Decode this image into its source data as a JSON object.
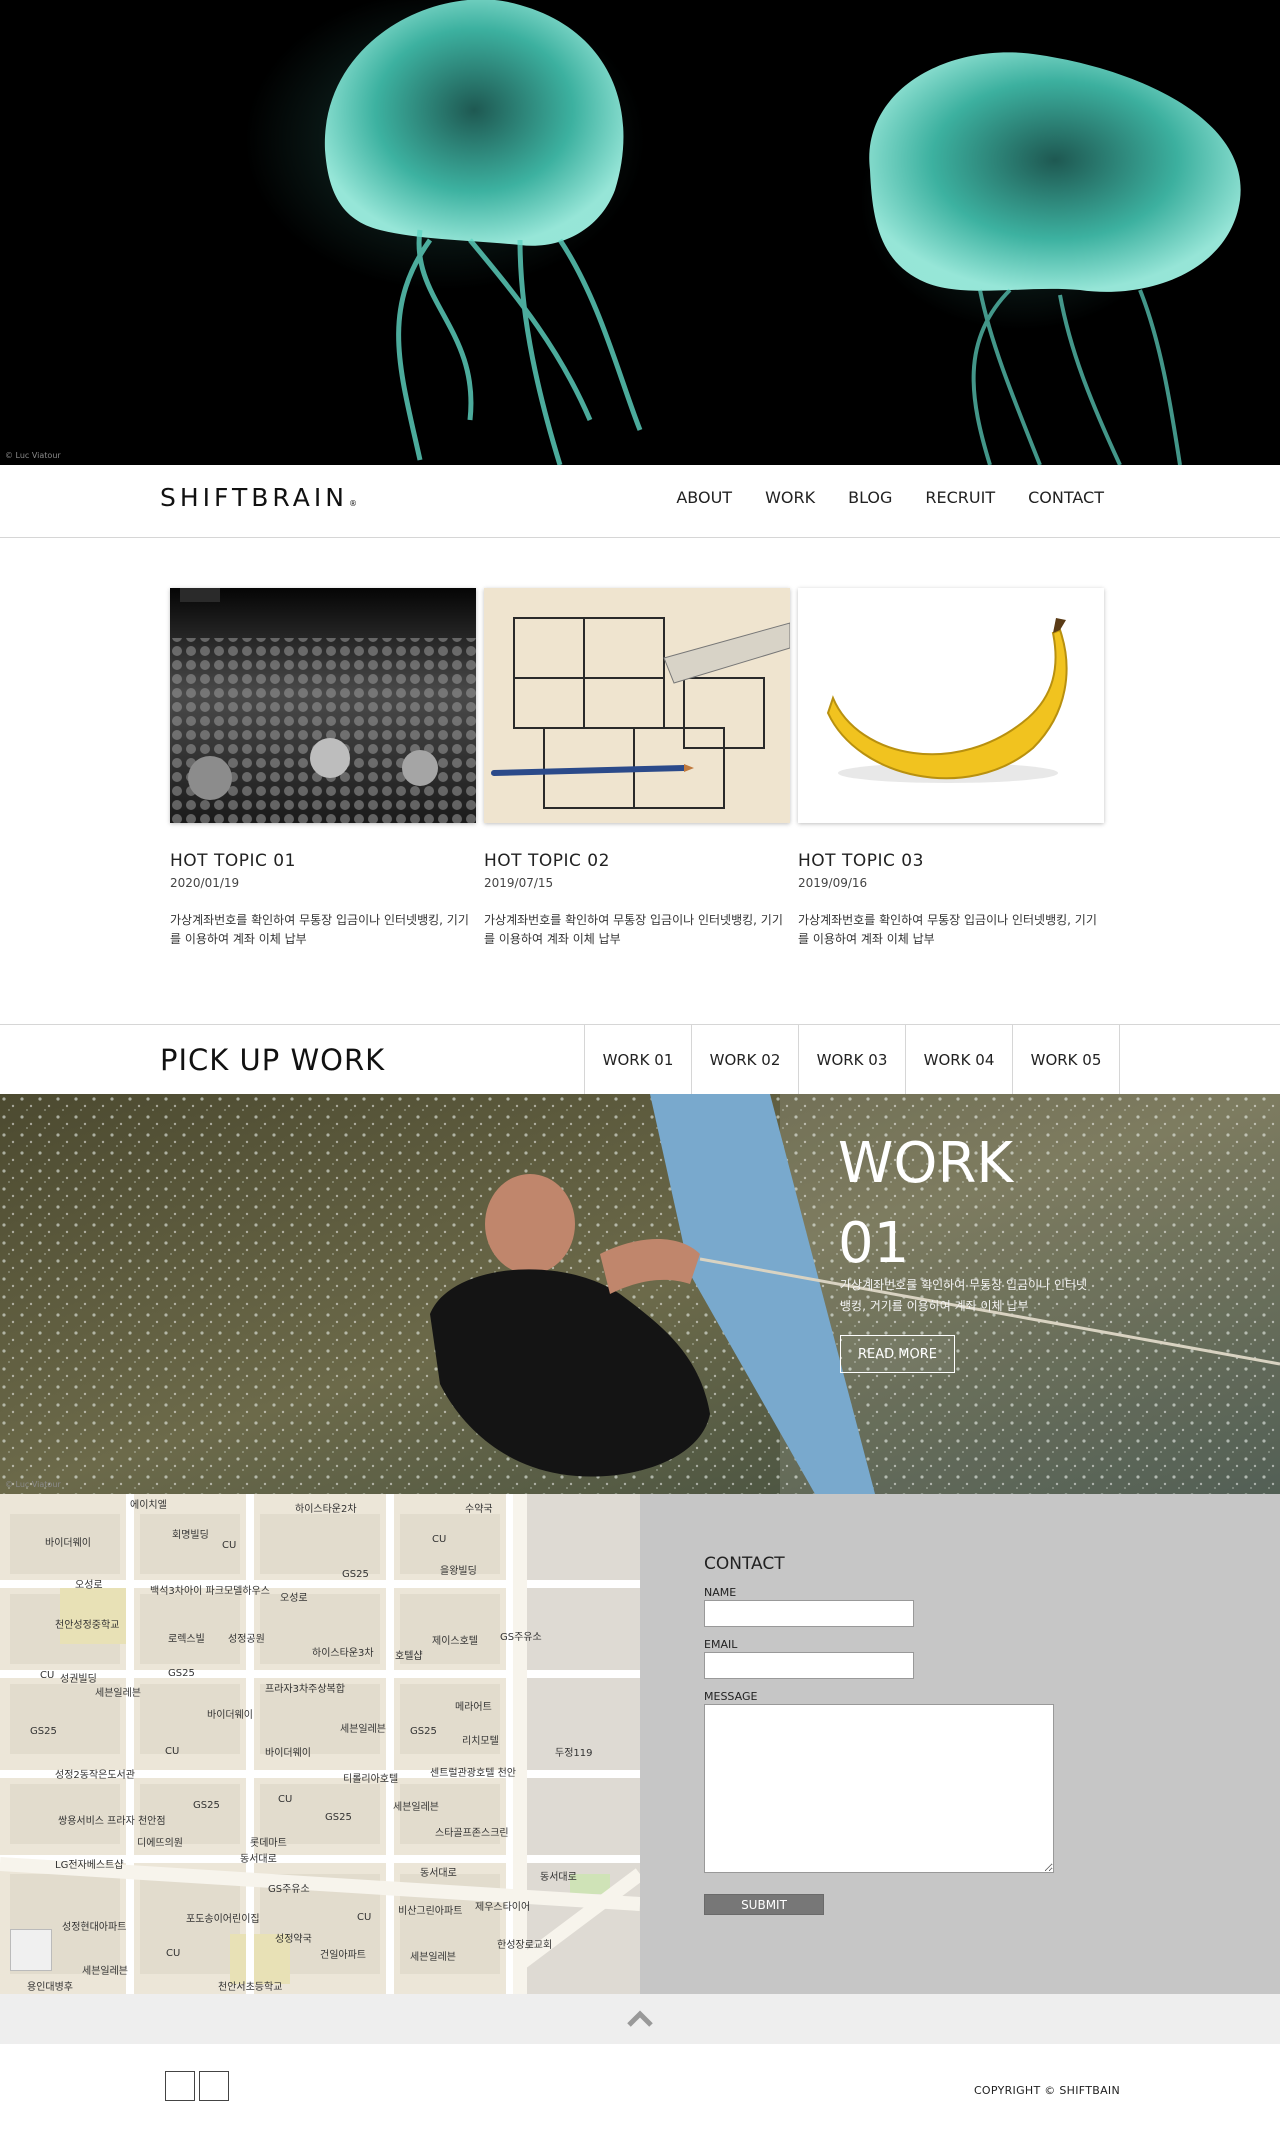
{
  "hero": {
    "credit": "© Luc Viatour"
  },
  "header": {
    "logo": "SHIFTBRAIN",
    "logo_mark": "®",
    "nav": [
      "ABOUT",
      "WORK",
      "BLOG",
      "RECRUIT",
      "CONTACT"
    ]
  },
  "topics": [
    {
      "title": "HOT TOPIC 01",
      "date": "2020/01/19",
      "text": "가상계좌번호를 확인하여 무통장 입금이나 인터넷뱅킹, 기기를 이용하여 계좌 이체 납부"
    },
    {
      "title": "HOT TOPIC 02",
      "date": "2019/07/15",
      "text": "가상계좌번호를 확인하여 무통장 입금이나 인터넷뱅킹, 기기를 이용하여 계좌 이체 납부"
    },
    {
      "title": "HOT TOPIC 03",
      "date": "2019/09/16",
      "text": "가상계좌번호를 확인하여 무통장 입금이나 인터넷뱅킹, 기기를 이용하여 계좌 이체 납부"
    }
  ],
  "pickup": {
    "title": "PICK UP WORK",
    "tabs": [
      "WORK 01",
      "WORK 02",
      "WORK 03",
      "WORK 04",
      "WORK 05"
    ],
    "work_title_1": "WORK",
    "work_title_2": "01",
    "description": "가상계좌번호를 확인하여 무통장 입금이나 인터넷뱅킹, 기기를 이용하여 계좌 이체 납부",
    "read_more": "READ MORE",
    "credit": "© Luc Viatour"
  },
  "map": {
    "labels": [
      "에이치엘",
      "하이스타운2차",
      "수약국",
      "바이더웨이",
      "회명빌딩",
      "CU",
      "CU",
      "오성로",
      "백석3차아이 파크모델하우스",
      "GS25",
      "을왕빌딩",
      "오성로",
      "천안성정중학교",
      "로렉스빌",
      "성정공원",
      "제이스호텔",
      "GS주유소",
      "하이스타운3차",
      "호텔샵",
      "CU",
      "성권빌딩",
      "GS25",
      "세븐일레븐",
      "프라자3차주상복합",
      "메라어트",
      "바이더웨이",
      "세븐일레븐",
      "GS25",
      "리치모텔",
      "GS25",
      "두정119",
      "CU",
      "바이더웨이",
      "성정2동작은도서관",
      "티롤리아호텔",
      "센트럴관광호텔 천안",
      "GS25",
      "CU",
      "세븐일레븐",
      "쌍용서비스 프라자 천안점",
      "GS25",
      "스타골프존스크린",
      "디에뜨의원",
      "롯데마트",
      "동서대로",
      "동서대로",
      "동서대로",
      "LG전자베스트샵",
      "GS주유소",
      "비산그린아파트",
      "제우스타이어",
      "포도송이어린이집",
      "성정약국",
      "CU",
      "한성장로교회",
      "성정현대아파트",
      "건일아파트",
      "세븐일레븐",
      "CU",
      "세븐일레븐",
      "용인대병후",
      "천안서초등학교"
    ]
  },
  "contact": {
    "title": "CONTACT",
    "name_label": "NAME",
    "email_label": "EMAIL",
    "message_label": "MESSAGE",
    "submit": "SUBMIT"
  },
  "footer": {
    "copyright": "COPYRIGHT © SHIFTBAIN"
  }
}
